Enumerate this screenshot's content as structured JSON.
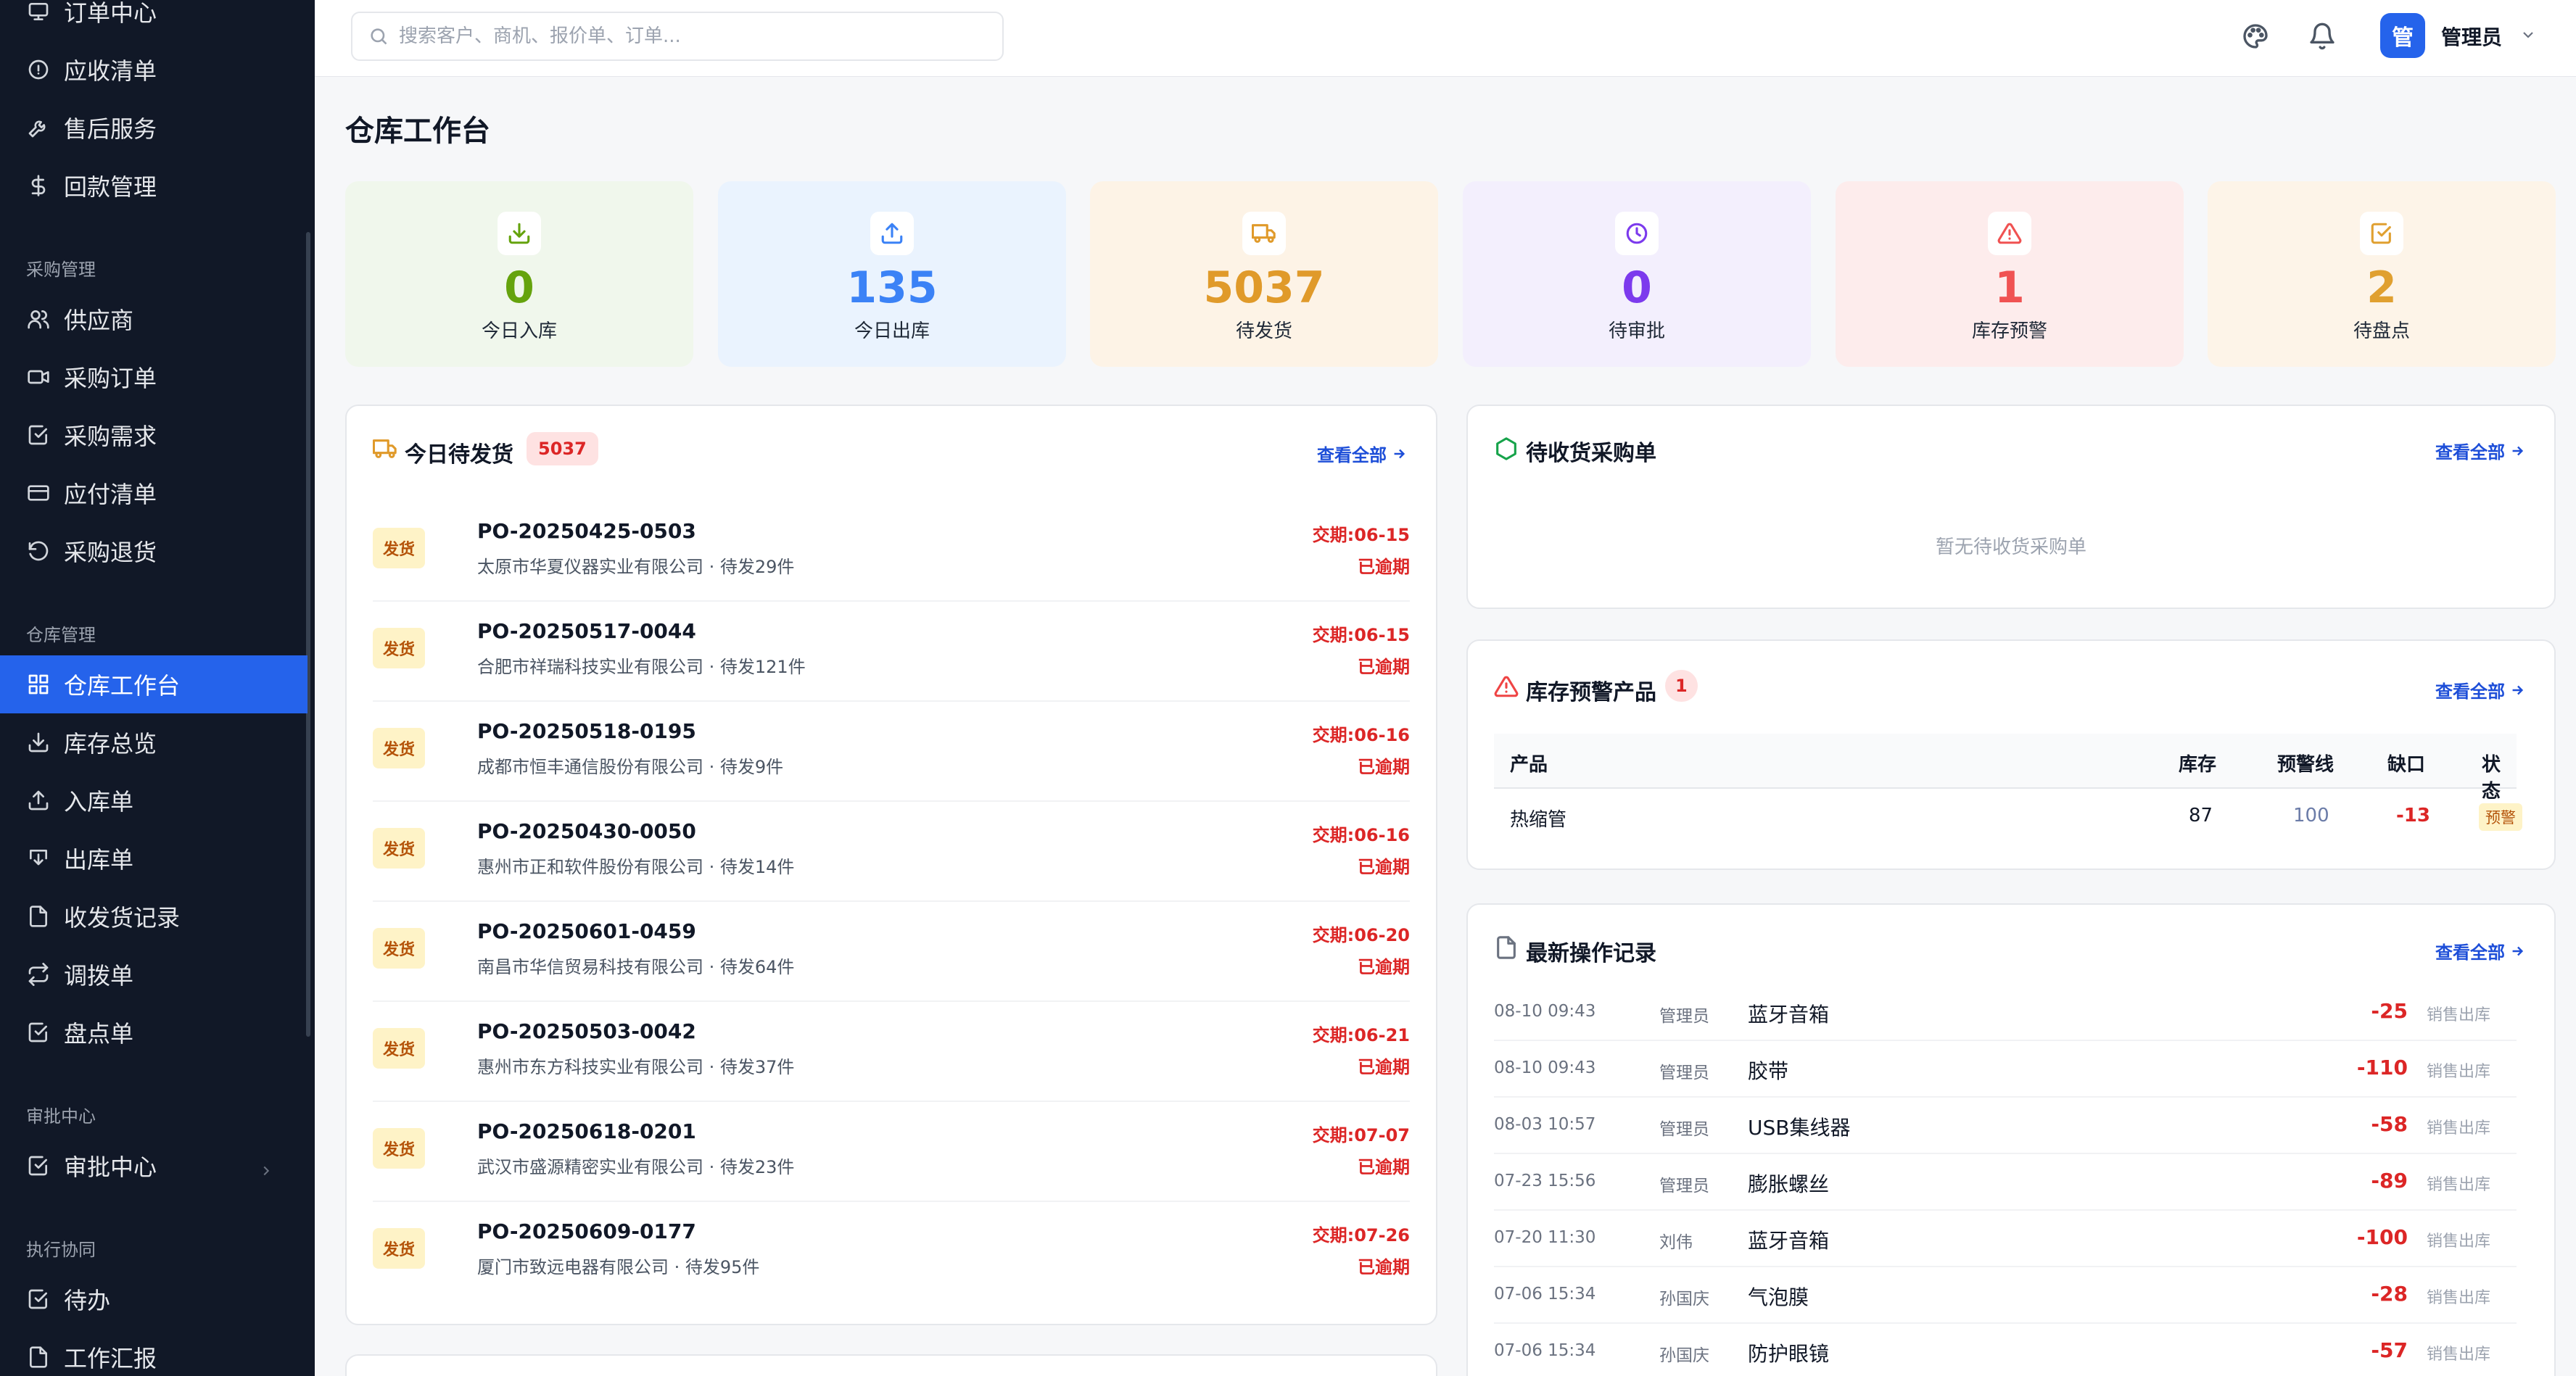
{
  "sidebar": {
    "top_items": [
      {
        "label": "订单中心",
        "icon": "monitor-icon"
      },
      {
        "label": "应收清单",
        "icon": "alert-circle-icon"
      },
      {
        "label": "售后服务",
        "icon": "wrench-icon"
      },
      {
        "label": "回款管理",
        "icon": "dollar-icon"
      }
    ],
    "groups": {
      "purchase": "采购管理",
      "warehouse": "仓库管理",
      "approval": "审批中心",
      "collab": "执行协同"
    },
    "purchase_items": [
      {
        "label": "供应商",
        "icon": "users-icon"
      },
      {
        "label": "采购订单",
        "icon": "video-icon"
      },
      {
        "label": "采购需求",
        "icon": "check-square-icon"
      },
      {
        "label": "应付清单",
        "icon": "credit-card-icon"
      },
      {
        "label": "采购退货",
        "icon": "rotate-ccw-icon"
      }
    ],
    "warehouse_items": [
      {
        "label": "仓库工作台",
        "icon": "grid-icon"
      },
      {
        "label": "库存总览",
        "icon": "download-icon"
      },
      {
        "label": "入库单",
        "icon": "upload-icon"
      },
      {
        "label": "出库单",
        "icon": "download-box-icon"
      },
      {
        "label": "收发货记录",
        "icon": "file-icon"
      },
      {
        "label": "调拨单",
        "icon": "repeat-icon"
      },
      {
        "label": "盘点单",
        "icon": "check-square-icon"
      }
    ],
    "approval_items": [
      {
        "label": "审批中心",
        "icon": "check-square-icon"
      }
    ],
    "collab_items": [
      {
        "label": "待办",
        "icon": "check-square-icon"
      },
      {
        "label": "工作汇报",
        "icon": "file-icon"
      }
    ]
  },
  "topbar": {
    "search_placeholder": "搜索客户、商机、报价单、订单...",
    "avatar_text": "管",
    "user_name": "管理员"
  },
  "page": {
    "title": "仓库工作台"
  },
  "stats": [
    {
      "value": "0",
      "label": "今日入库",
      "color": "#65a30d",
      "bg": "#f0f7ec",
      "icon": "download-icon"
    },
    {
      "value": "135",
      "label": "今日出库",
      "color": "#3b82f6",
      "bg": "#eaf3fe",
      "icon": "upload-icon"
    },
    {
      "value": "5037",
      "label": "待发货",
      "color": "#e09a2a",
      "bg": "#fdf3e6",
      "icon": "truck-icon"
    },
    {
      "value": "0",
      "label": "待审批",
      "color": "#7c3aed",
      "bg": "#f3effd",
      "icon": "clock-icon"
    },
    {
      "value": "1",
      "label": "库存预警",
      "color": "#f05252",
      "bg": "#fdecec",
      "icon": "alert-triangle-icon"
    },
    {
      "value": "2",
      "label": "待盘点",
      "color": "#e0a030",
      "bg": "#fdf4e8",
      "icon": "check-square-icon"
    }
  ],
  "shipments": {
    "title": "今日待发货",
    "count": "5037",
    "view_all": "查看全部",
    "rows": [
      {
        "tag": "发货",
        "po": "PO-20250425-0503",
        "sub": "太原市华夏仪器实业有限公司 · 待发29件",
        "due": "交期:06-15",
        "status": "已逾期"
      },
      {
        "tag": "发货",
        "po": "PO-20250517-0044",
        "sub": "合肥市祥瑞科技实业有限公司 · 待发121件",
        "due": "交期:06-15",
        "status": "已逾期"
      },
      {
        "tag": "发货",
        "po": "PO-20250518-0195",
        "sub": "成都市恒丰通信股份有限公司 · 待发9件",
        "due": "交期:06-16",
        "status": "已逾期"
      },
      {
        "tag": "发货",
        "po": "PO-20250430-0050",
        "sub": "惠州市正和软件股份有限公司 · 待发14件",
        "due": "交期:06-16",
        "status": "已逾期"
      },
      {
        "tag": "发货",
        "po": "PO-20250601-0459",
        "sub": "南昌市华信贸易科技有限公司 · 待发64件",
        "due": "交期:06-20",
        "status": "已逾期"
      },
      {
        "tag": "发货",
        "po": "PO-20250503-0042",
        "sub": "惠州市东方科技实业有限公司 · 待发37件",
        "due": "交期:06-21",
        "status": "已逾期"
      },
      {
        "tag": "发货",
        "po": "PO-20250618-0201",
        "sub": "武汉市盛源精密实业有限公司 · 待发23件",
        "due": "交期:07-07",
        "status": "已逾期"
      },
      {
        "tag": "发货",
        "po": "PO-20250609-0177",
        "sub": "厦门市致远电器有限公司 · 待发95件",
        "due": "交期:07-26",
        "status": "已逾期"
      }
    ]
  },
  "pending_receipts": {
    "title": "待收货采购单",
    "view_all": "查看全部",
    "empty": "暂无待收货采购单"
  },
  "stock_alerts": {
    "title": "库存预警产品",
    "count": "1",
    "view_all": "查看全部",
    "headers": {
      "product": "产品",
      "stock": "库存",
      "threshold": "预警线",
      "gap": "缺口",
      "status": "状态"
    },
    "rows": [
      {
        "product": "热缩管",
        "stock": "87",
        "threshold": "100",
        "gap": "-13",
        "status": "预警"
      }
    ]
  },
  "logs": {
    "title": "最新操作记录",
    "view_all": "查看全部",
    "rows": [
      {
        "time": "08-10 09:43",
        "user": "管理员",
        "item": "蓝牙音箱",
        "qty": "-25",
        "type": "销售出库"
      },
      {
        "time": "08-10 09:43",
        "user": "管理员",
        "item": "胶带",
        "qty": "-110",
        "type": "销售出库"
      },
      {
        "time": "08-03 10:57",
        "user": "管理员",
        "item": "USB集线器",
        "qty": "-58",
        "type": "销售出库"
      },
      {
        "time": "07-23 15:56",
        "user": "管理员",
        "item": "膨胀螺丝",
        "qty": "-89",
        "type": "销售出库"
      },
      {
        "time": "07-20 11:30",
        "user": "刘伟",
        "item": "蓝牙音箱",
        "qty": "-100",
        "type": "销售出库"
      },
      {
        "time": "07-06 15:34",
        "user": "孙国庆",
        "item": "气泡膜",
        "qty": "-28",
        "type": "销售出库"
      },
      {
        "time": "07-06 15:34",
        "user": "孙国庆",
        "item": "防护眼镜",
        "qty": "-57",
        "type": "销售出库"
      }
    ]
  }
}
